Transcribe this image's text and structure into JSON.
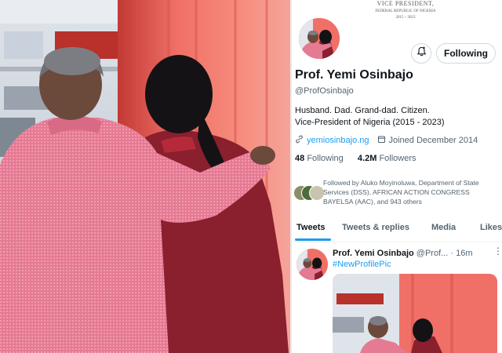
{
  "banner": {
    "line1": "VICE PRESIDENT,",
    "line2": "FEDERAL REPUBLIC OF NIGERIA",
    "line3": "2015 – 2023"
  },
  "profile": {
    "name": "Prof. Yemi Osinbajo",
    "handle": "@ProfOsinbajo",
    "bio_line1": "Husband. Dad. Grand-dad. Citizen.",
    "bio_line2": "Vice-President of Nigeria (2015 - 2023)",
    "website": "yemiosinbajo.ng",
    "joined": "Joined December 2014",
    "following_count": "48",
    "following_label": "Following",
    "followers_count": "4.2M",
    "followers_label": "Followers",
    "follow_button": "Following",
    "followed_by": "Followed by Aluko Moyinoluwa, Department of State Services (DSS), AFRICAN ACTION CONGRESS BAYELSA (AAC), and 943 others"
  },
  "tabs": [
    "Tweets",
    "Tweets & replies",
    "Media",
    "Likes"
  ],
  "tweet": {
    "name": "Prof. Yemi Osinbajo",
    "handle": "@Prof...",
    "time": "· 16m",
    "more": "⋮",
    "text": "#NewProfilePic"
  },
  "colors": {
    "accent": "#1d9bf0",
    "shirt": "#e0738f",
    "dress": "#8a1f2e",
    "curtain": "#f06a68"
  },
  "icons": [
    "bell-plus-icon",
    "link-icon",
    "calendar-icon",
    "more-icon"
  ]
}
